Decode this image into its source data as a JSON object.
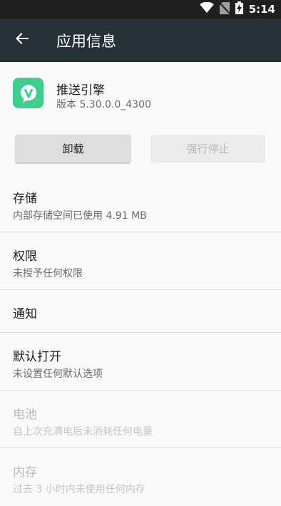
{
  "status_bar": {
    "time": "5:14",
    "icons": [
      "wifi-icon",
      "no-sim-icon",
      "battery-charging-icon"
    ]
  },
  "app_bar": {
    "title": "应用信息",
    "back_icon": "arrow-back-icon"
  },
  "app": {
    "name": "推送引擎",
    "version": "版本 5.30.0.0_4300",
    "icon_color": "#3ecf8e"
  },
  "buttons": {
    "uninstall": "卸载",
    "force_stop": "强行停止"
  },
  "items": [
    {
      "title": "存储",
      "subtitle": "内部存储空间已使用 4.91 MB",
      "enabled": true
    },
    {
      "title": "权限",
      "subtitle": "未授予任何权限",
      "enabled": true
    },
    {
      "title": "通知",
      "subtitle": "",
      "enabled": true
    },
    {
      "title": "默认打开",
      "subtitle": "未设置任何默认选项",
      "enabled": true
    },
    {
      "title": "电池",
      "subtitle": "自上次充满电后未消耗任何电量",
      "enabled": false
    },
    {
      "title": "内存",
      "subtitle": "过去 3 小时内未使用任何内存",
      "enabled": false
    }
  ],
  "colors": {
    "app_bar": "#263238",
    "status_bar": "#1f1f1f",
    "accent": "#3ecf8e"
  }
}
